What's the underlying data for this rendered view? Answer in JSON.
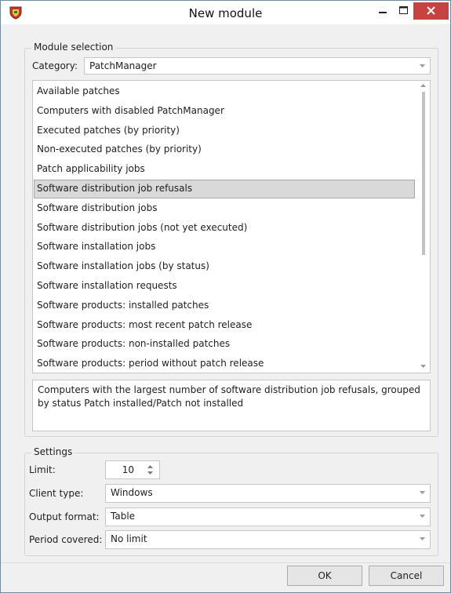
{
  "window": {
    "title": "New module",
    "app_icon": "shield-app-icon",
    "controls": [
      "minimize-icon",
      "maximize-icon",
      "close-icon"
    ],
    "close_color": "#c7433f"
  },
  "module_selection": {
    "legend": "Module selection",
    "category_label": "Category:",
    "category_value": "PatchManager",
    "items": [
      "Available patches",
      "Computers with disabled PatchManager",
      "Executed patches (by priority)",
      "Non-executed patches (by priority)",
      "Patch applicability jobs",
      "Software distribution job refusals",
      "Software distribution jobs",
      "Software distribution jobs (not yet executed)",
      "Software installation jobs",
      "Software installation jobs (by status)",
      "Software installation requests",
      "Software products: installed patches",
      "Software products: most recent patch release",
      "Software products: non-installed patches",
      "Software products: period without patch release"
    ],
    "selected_item": "Software distribution job refusals",
    "description": "Computers with the largest number of software distribution job refusals, grouped by status Patch installed/Patch not installed"
  },
  "settings": {
    "legend": "Settings",
    "limit_label": "Limit:",
    "limit_value": "10",
    "client_type_label": "Client type:",
    "client_type_value": "Windows",
    "output_format_label": "Output format:",
    "output_format_value": "Table",
    "period_label": "Period covered:",
    "period_value": "No limit"
  },
  "buttons": {
    "ok": "OK",
    "cancel": "Cancel"
  }
}
